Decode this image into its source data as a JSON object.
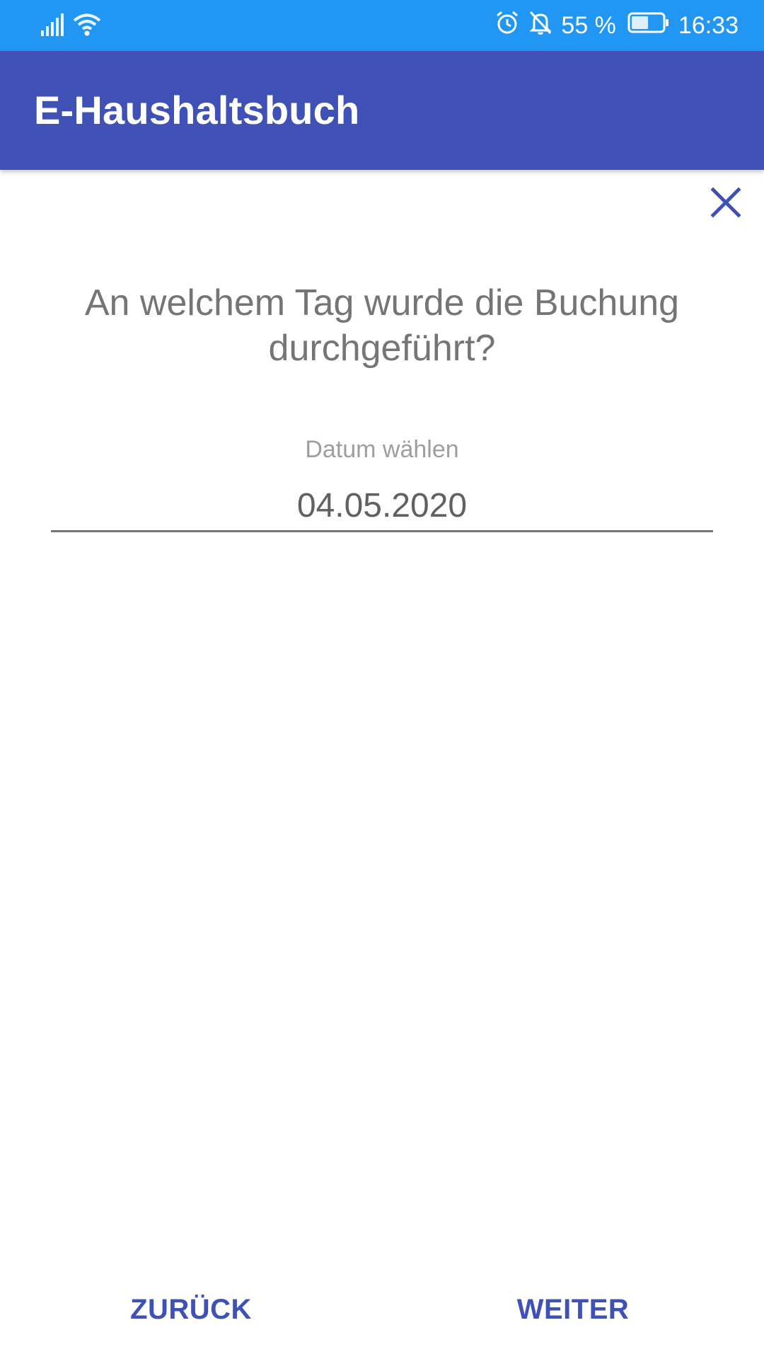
{
  "status_bar": {
    "battery_percent_text": "55 %",
    "battery_level": 0.55,
    "time": "16:33",
    "icons": [
      "signal-icon",
      "wifi-icon",
      "alarm-icon",
      "notifications-off-icon",
      "battery-icon"
    ]
  },
  "app_bar": {
    "title": "E-Haushaltsbuch"
  },
  "close": {
    "icon": "close-icon"
  },
  "question": {
    "text": "An welchem Tag wurde die Buchung durchgeführt?"
  },
  "date_field": {
    "label": "Datum wählen",
    "value": "04.05.2020"
  },
  "buttons": {
    "back_label": "ZURÜCK",
    "next_label": "WEITER"
  },
  "colors": {
    "status_bar": "#2196F3",
    "app_bar": "#3F51B5",
    "accent": "#3F51B5",
    "text_primary": "#757575",
    "text_hint": "#9E9E9E"
  }
}
